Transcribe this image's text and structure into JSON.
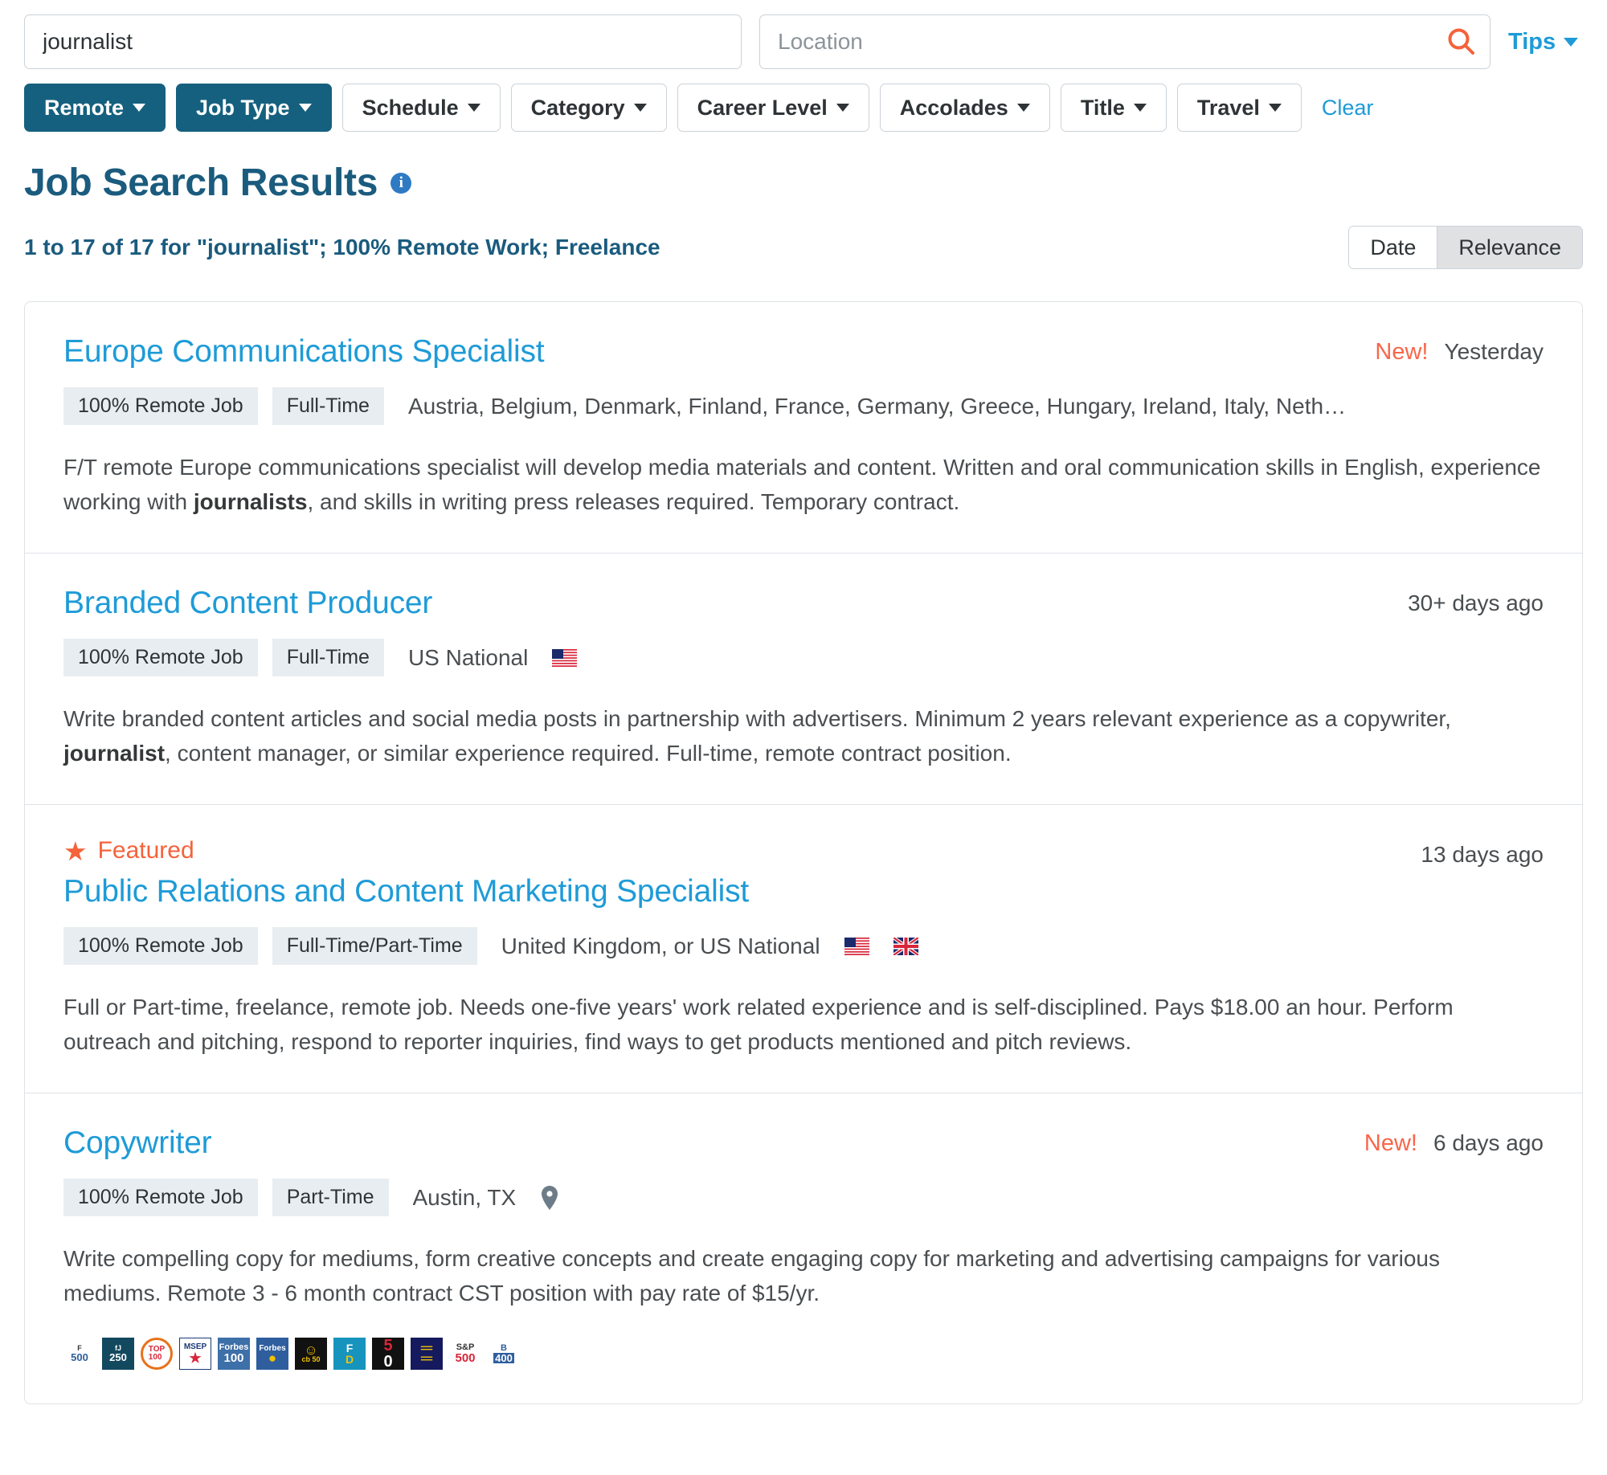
{
  "search": {
    "keyword_value": "journalist",
    "keyword_placeholder": "",
    "location_value": "",
    "location_placeholder": "Location",
    "search_icon": "search-icon",
    "tips_label": "Tips"
  },
  "filters": {
    "items": [
      {
        "label": "Remote",
        "active": true
      },
      {
        "label": "Job Type",
        "active": true
      },
      {
        "label": "Schedule",
        "active": false
      },
      {
        "label": "Category",
        "active": false
      },
      {
        "label": "Career Level",
        "active": false
      },
      {
        "label": "Accolades",
        "active": false
      },
      {
        "label": "Title",
        "active": false
      },
      {
        "label": "Travel",
        "active": false
      }
    ],
    "clear_label": "Clear"
  },
  "heading": {
    "title": "Job Search Results",
    "info_icon": "info-icon",
    "summary": "1 to 17 of 17 for \"journalist\"; 100% Remote Work; Freelance"
  },
  "sort": {
    "date_label": "Date",
    "relevance_label": "Relevance",
    "active": "Relevance"
  },
  "jobs": [
    {
      "title": "Europe Communications Specialist",
      "featured": false,
      "new_label": "New!",
      "date": "Yesterday",
      "tags": [
        "100% Remote Job",
        "Full-Time"
      ],
      "location": "Austria, Belgium, Denmark, Finland, France, Germany, Greece, Hungary, Ireland, Italy, Netherlands, Norw…",
      "flags": [],
      "pin": false,
      "desc_pre": "F/T remote Europe communications specialist will develop media materials and content. Written and oral communication skills in English, experience working with ",
      "desc_bold": "journalists",
      "desc_post": ", and skills in writing press releases required. Temporary contract."
    },
    {
      "title": "Branded Content Producer",
      "featured": false,
      "new_label": "",
      "date": "30+ days ago",
      "tags": [
        "100% Remote Job",
        "Full-Time"
      ],
      "location": "US National",
      "flags": [
        "us"
      ],
      "pin": false,
      "desc_pre": "Write branded content articles and social media posts in partnership with advertisers. Minimum 2 years relevant experience as a copywriter, ",
      "desc_bold": "journalist",
      "desc_post": ", content manager, or similar experience required. Full-time, remote contract position."
    },
    {
      "title": "Public Relations and Content Marketing Specialist",
      "featured": true,
      "featured_label": "Featured",
      "new_label": "",
      "date": "13 days ago",
      "tags": [
        "100% Remote Job",
        "Full-Time/Part-Time"
      ],
      "location": "United Kingdom, or US National",
      "flags": [
        "us",
        "uk"
      ],
      "pin": false,
      "desc_pre": "Full or Part-time, freelance, remote job. Needs one-five years' work related experience and is self-disciplined. Pays $18.00 an hour. Perform outreach and pitching, respond to reporter inquiries, find ways to get products mentioned and pitch reviews.",
      "desc_bold": "",
      "desc_post": ""
    },
    {
      "title": "Copywriter",
      "featured": false,
      "new_label": "New!",
      "date": "6 days ago",
      "tags": [
        "100% Remote Job",
        "Part-Time"
      ],
      "location": "Austin, TX",
      "flags": [],
      "pin": true,
      "desc_pre": "Write compelling copy for mediums, form creative concepts and create engaging copy for marketing and advertising campaigns for various mediums. Remote 3 - 6 month contract CST position with pay rate of $15/yr.",
      "desc_bold": "",
      "desc_post": ""
    }
  ],
  "accolade_badges": [
    {
      "name": "fortune-500-badge",
      "top": "F",
      "bottom": "500"
    },
    {
      "name": "fj-250-badge",
      "top": "fJ",
      "bottom": "250"
    },
    {
      "name": "top-100-badge",
      "top": "TOP",
      "bottom": "100"
    },
    {
      "name": "msep-badge",
      "top": "MSEP",
      "bottom": "★"
    },
    {
      "name": "forbes-100-badge",
      "top": "Forbes",
      "bottom": "100"
    },
    {
      "name": "forbes-globe-badge",
      "top": "Forbes",
      "bottom": "●"
    },
    {
      "name": "cb-50-badge",
      "top": "☺",
      "bottom": "cb 50"
    },
    {
      "name": "fd-badge",
      "top": "F",
      "bottom": "D"
    },
    {
      "name": "top-50-badge",
      "top": "",
      "bottom": "50"
    },
    {
      "name": "equality-badge",
      "top": "═",
      "bottom": "═"
    },
    {
      "name": "sp-500-badge",
      "top": "S&P",
      "bottom": "500"
    },
    {
      "name": "b-400-badge",
      "top": "B",
      "bottom": "400"
    }
  ],
  "colors": {
    "brand_dark": "#15607E",
    "link_blue": "#1E9BD7",
    "title_blue": "#1A5B7E",
    "coral": "#F8664A",
    "orange": "#F4633A",
    "tag_bg": "#E8EDF1"
  }
}
